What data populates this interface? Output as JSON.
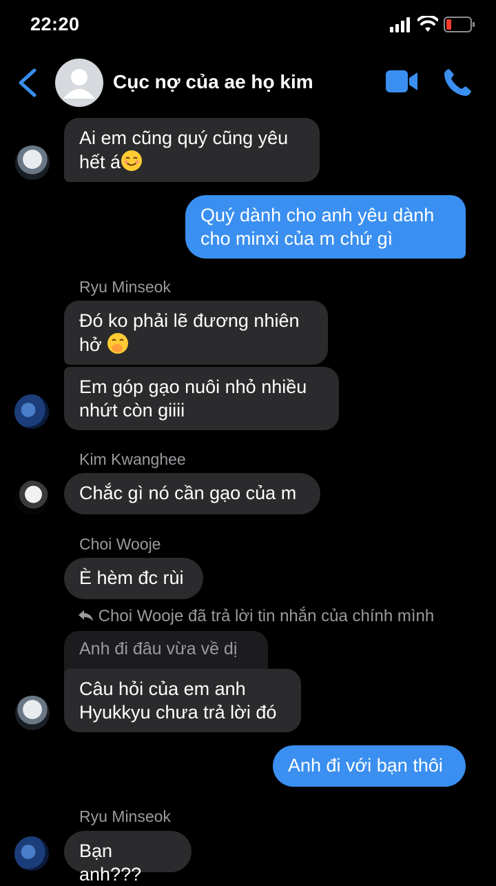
{
  "status_bar": {
    "time": "22:20"
  },
  "header": {
    "title": "Cục nợ của ae họ kim"
  },
  "messages": {
    "m1": {
      "text": "Ai em cũng quý cũng yêu hết á"
    },
    "m2": {
      "text": "Quý dành cho anh yêu dành cho minxi của m chứ gì"
    },
    "s1": {
      "name": "Ryu Minseok"
    },
    "m3": {
      "text": "Đó ko phải lẽ đương nhiên hở"
    },
    "m4": {
      "text": "Em góp gạo nuôi nhỏ nhiều nhứt còn giiii"
    },
    "s2": {
      "name": "Kim Kwanghee"
    },
    "m5": {
      "text": "Chắc gì nó cần gạo của m"
    },
    "s3": {
      "name": "Choi Wooje"
    },
    "m6": {
      "text": "È hèm đc rùi"
    },
    "reply": {
      "note": "Choi Wooje đã trả lời tin nhắn của chính mình",
      "quoted": "Anh đi đâu vừa về dị"
    },
    "m7": {
      "text": "Câu hỏi của em anh Hyukkyu chưa trả lời đó"
    },
    "m8": {
      "text": "Anh đi với bạn thôi"
    },
    "s4": {
      "name": "Ryu Minseok"
    },
    "m9": {
      "text": "Bạn anh???"
    }
  },
  "colors": {
    "outgoing": "#3a8ff0",
    "incoming": "#2b2b2d",
    "accent": "#3a8ff0"
  }
}
